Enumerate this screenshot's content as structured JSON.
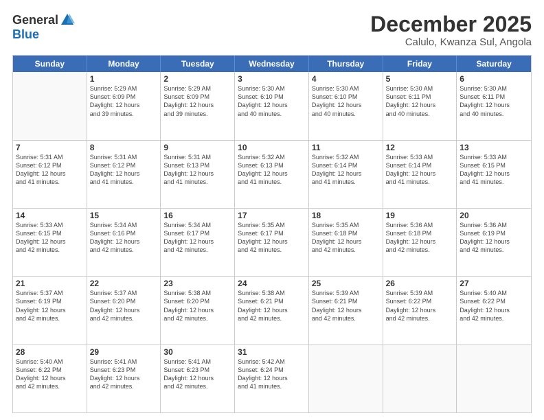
{
  "header": {
    "logo_general": "General",
    "logo_blue": "Blue",
    "month_title": "December 2025",
    "location": "Calulo, Kwanza Sul, Angola"
  },
  "calendar": {
    "days_of_week": [
      "Sunday",
      "Monday",
      "Tuesday",
      "Wednesday",
      "Thursday",
      "Friday",
      "Saturday"
    ],
    "weeks": [
      [
        {
          "day": "",
          "info": ""
        },
        {
          "day": "1",
          "info": "Sunrise: 5:29 AM\nSunset: 6:09 PM\nDaylight: 12 hours\nand 39 minutes."
        },
        {
          "day": "2",
          "info": "Sunrise: 5:29 AM\nSunset: 6:09 PM\nDaylight: 12 hours\nand 39 minutes."
        },
        {
          "day": "3",
          "info": "Sunrise: 5:30 AM\nSunset: 6:10 PM\nDaylight: 12 hours\nand 40 minutes."
        },
        {
          "day": "4",
          "info": "Sunrise: 5:30 AM\nSunset: 6:10 PM\nDaylight: 12 hours\nand 40 minutes."
        },
        {
          "day": "5",
          "info": "Sunrise: 5:30 AM\nSunset: 6:11 PM\nDaylight: 12 hours\nand 40 minutes."
        },
        {
          "day": "6",
          "info": "Sunrise: 5:30 AM\nSunset: 6:11 PM\nDaylight: 12 hours\nand 40 minutes."
        }
      ],
      [
        {
          "day": "7",
          "info": "Sunrise: 5:31 AM\nSunset: 6:12 PM\nDaylight: 12 hours\nand 41 minutes."
        },
        {
          "day": "8",
          "info": "Sunrise: 5:31 AM\nSunset: 6:12 PM\nDaylight: 12 hours\nand 41 minutes."
        },
        {
          "day": "9",
          "info": "Sunrise: 5:31 AM\nSunset: 6:13 PM\nDaylight: 12 hours\nand 41 minutes."
        },
        {
          "day": "10",
          "info": "Sunrise: 5:32 AM\nSunset: 6:13 PM\nDaylight: 12 hours\nand 41 minutes."
        },
        {
          "day": "11",
          "info": "Sunrise: 5:32 AM\nSunset: 6:14 PM\nDaylight: 12 hours\nand 41 minutes."
        },
        {
          "day": "12",
          "info": "Sunrise: 5:33 AM\nSunset: 6:14 PM\nDaylight: 12 hours\nand 41 minutes."
        },
        {
          "day": "13",
          "info": "Sunrise: 5:33 AM\nSunset: 6:15 PM\nDaylight: 12 hours\nand 41 minutes."
        }
      ],
      [
        {
          "day": "14",
          "info": "Sunrise: 5:33 AM\nSunset: 6:15 PM\nDaylight: 12 hours\nand 42 minutes."
        },
        {
          "day": "15",
          "info": "Sunrise: 5:34 AM\nSunset: 6:16 PM\nDaylight: 12 hours\nand 42 minutes."
        },
        {
          "day": "16",
          "info": "Sunrise: 5:34 AM\nSunset: 6:17 PM\nDaylight: 12 hours\nand 42 minutes."
        },
        {
          "day": "17",
          "info": "Sunrise: 5:35 AM\nSunset: 6:17 PM\nDaylight: 12 hours\nand 42 minutes."
        },
        {
          "day": "18",
          "info": "Sunrise: 5:35 AM\nSunset: 6:18 PM\nDaylight: 12 hours\nand 42 minutes."
        },
        {
          "day": "19",
          "info": "Sunrise: 5:36 AM\nSunset: 6:18 PM\nDaylight: 12 hours\nand 42 minutes."
        },
        {
          "day": "20",
          "info": "Sunrise: 5:36 AM\nSunset: 6:19 PM\nDaylight: 12 hours\nand 42 minutes."
        }
      ],
      [
        {
          "day": "21",
          "info": "Sunrise: 5:37 AM\nSunset: 6:19 PM\nDaylight: 12 hours\nand 42 minutes."
        },
        {
          "day": "22",
          "info": "Sunrise: 5:37 AM\nSunset: 6:20 PM\nDaylight: 12 hours\nand 42 minutes."
        },
        {
          "day": "23",
          "info": "Sunrise: 5:38 AM\nSunset: 6:20 PM\nDaylight: 12 hours\nand 42 minutes."
        },
        {
          "day": "24",
          "info": "Sunrise: 5:38 AM\nSunset: 6:21 PM\nDaylight: 12 hours\nand 42 minutes."
        },
        {
          "day": "25",
          "info": "Sunrise: 5:39 AM\nSunset: 6:21 PM\nDaylight: 12 hours\nand 42 minutes."
        },
        {
          "day": "26",
          "info": "Sunrise: 5:39 AM\nSunset: 6:22 PM\nDaylight: 12 hours\nand 42 minutes."
        },
        {
          "day": "27",
          "info": "Sunrise: 5:40 AM\nSunset: 6:22 PM\nDaylight: 12 hours\nand 42 minutes."
        }
      ],
      [
        {
          "day": "28",
          "info": "Sunrise: 5:40 AM\nSunset: 6:22 PM\nDaylight: 12 hours\nand 42 minutes."
        },
        {
          "day": "29",
          "info": "Sunrise: 5:41 AM\nSunset: 6:23 PM\nDaylight: 12 hours\nand 42 minutes."
        },
        {
          "day": "30",
          "info": "Sunrise: 5:41 AM\nSunset: 6:23 PM\nDaylight: 12 hours\nand 42 minutes."
        },
        {
          "day": "31",
          "info": "Sunrise: 5:42 AM\nSunset: 6:24 PM\nDaylight: 12 hours\nand 41 minutes."
        },
        {
          "day": "",
          "info": ""
        },
        {
          "day": "",
          "info": ""
        },
        {
          "day": "",
          "info": ""
        }
      ]
    ]
  }
}
